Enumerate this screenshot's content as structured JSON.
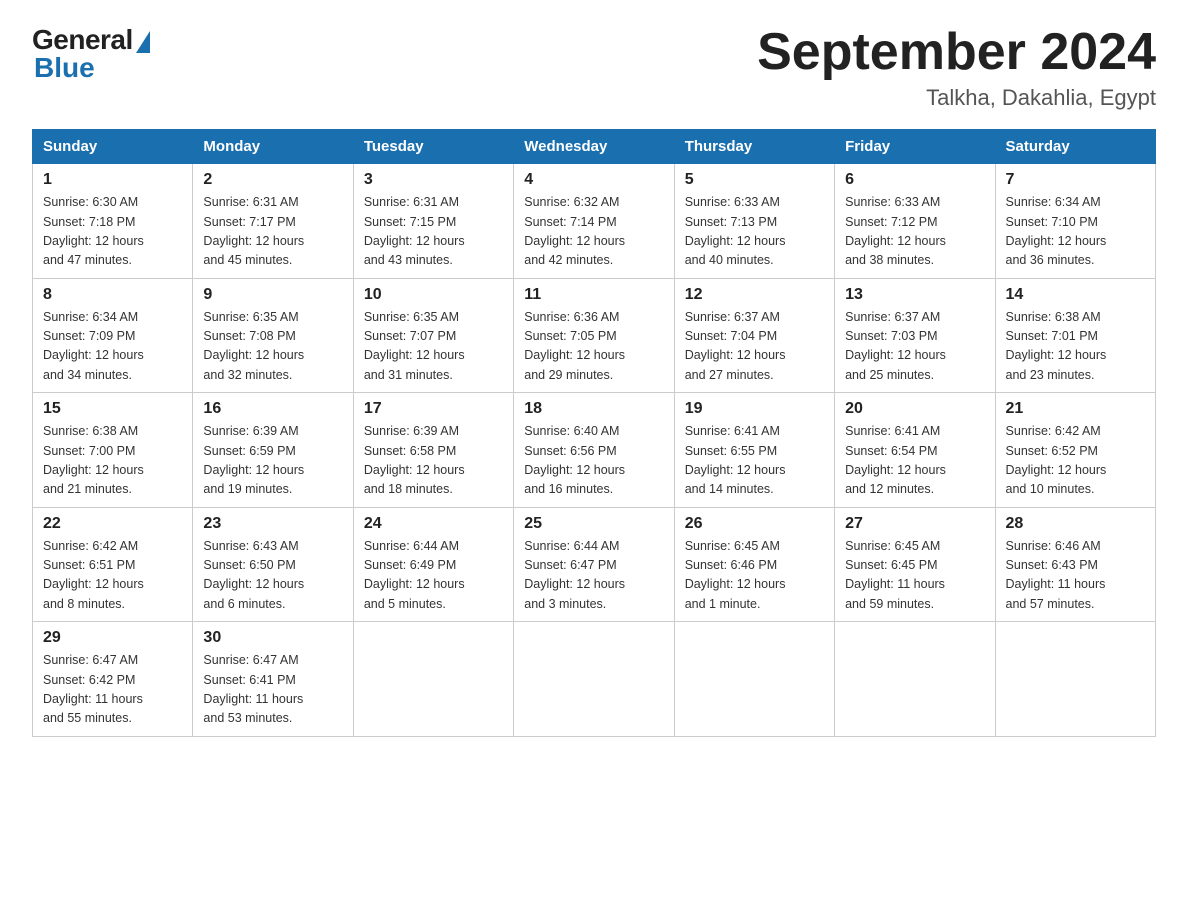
{
  "header": {
    "logo_general": "General",
    "logo_blue": "Blue",
    "month_title": "September 2024",
    "location": "Talkha, Dakahlia, Egypt"
  },
  "weekdays": [
    "Sunday",
    "Monday",
    "Tuesday",
    "Wednesday",
    "Thursday",
    "Friday",
    "Saturday"
  ],
  "weeks": [
    [
      {
        "day": "1",
        "sunrise": "6:30 AM",
        "sunset": "7:18 PM",
        "daylight": "12 hours and 47 minutes."
      },
      {
        "day": "2",
        "sunrise": "6:31 AM",
        "sunset": "7:17 PM",
        "daylight": "12 hours and 45 minutes."
      },
      {
        "day": "3",
        "sunrise": "6:31 AM",
        "sunset": "7:15 PM",
        "daylight": "12 hours and 43 minutes."
      },
      {
        "day": "4",
        "sunrise": "6:32 AM",
        "sunset": "7:14 PM",
        "daylight": "12 hours and 42 minutes."
      },
      {
        "day": "5",
        "sunrise": "6:33 AM",
        "sunset": "7:13 PM",
        "daylight": "12 hours and 40 minutes."
      },
      {
        "day": "6",
        "sunrise": "6:33 AM",
        "sunset": "7:12 PM",
        "daylight": "12 hours and 38 minutes."
      },
      {
        "day": "7",
        "sunrise": "6:34 AM",
        "sunset": "7:10 PM",
        "daylight": "12 hours and 36 minutes."
      }
    ],
    [
      {
        "day": "8",
        "sunrise": "6:34 AM",
        "sunset": "7:09 PM",
        "daylight": "12 hours and 34 minutes."
      },
      {
        "day": "9",
        "sunrise": "6:35 AM",
        "sunset": "7:08 PM",
        "daylight": "12 hours and 32 minutes."
      },
      {
        "day": "10",
        "sunrise": "6:35 AM",
        "sunset": "7:07 PM",
        "daylight": "12 hours and 31 minutes."
      },
      {
        "day": "11",
        "sunrise": "6:36 AM",
        "sunset": "7:05 PM",
        "daylight": "12 hours and 29 minutes."
      },
      {
        "day": "12",
        "sunrise": "6:37 AM",
        "sunset": "7:04 PM",
        "daylight": "12 hours and 27 minutes."
      },
      {
        "day": "13",
        "sunrise": "6:37 AM",
        "sunset": "7:03 PM",
        "daylight": "12 hours and 25 minutes."
      },
      {
        "day": "14",
        "sunrise": "6:38 AM",
        "sunset": "7:01 PM",
        "daylight": "12 hours and 23 minutes."
      }
    ],
    [
      {
        "day": "15",
        "sunrise": "6:38 AM",
        "sunset": "7:00 PM",
        "daylight": "12 hours and 21 minutes."
      },
      {
        "day": "16",
        "sunrise": "6:39 AM",
        "sunset": "6:59 PM",
        "daylight": "12 hours and 19 minutes."
      },
      {
        "day": "17",
        "sunrise": "6:39 AM",
        "sunset": "6:58 PM",
        "daylight": "12 hours and 18 minutes."
      },
      {
        "day": "18",
        "sunrise": "6:40 AM",
        "sunset": "6:56 PM",
        "daylight": "12 hours and 16 minutes."
      },
      {
        "day": "19",
        "sunrise": "6:41 AM",
        "sunset": "6:55 PM",
        "daylight": "12 hours and 14 minutes."
      },
      {
        "day": "20",
        "sunrise": "6:41 AM",
        "sunset": "6:54 PM",
        "daylight": "12 hours and 12 minutes."
      },
      {
        "day": "21",
        "sunrise": "6:42 AM",
        "sunset": "6:52 PM",
        "daylight": "12 hours and 10 minutes."
      }
    ],
    [
      {
        "day": "22",
        "sunrise": "6:42 AM",
        "sunset": "6:51 PM",
        "daylight": "12 hours and 8 minutes."
      },
      {
        "day": "23",
        "sunrise": "6:43 AM",
        "sunset": "6:50 PM",
        "daylight": "12 hours and 6 minutes."
      },
      {
        "day": "24",
        "sunrise": "6:44 AM",
        "sunset": "6:49 PM",
        "daylight": "12 hours and 5 minutes."
      },
      {
        "day": "25",
        "sunrise": "6:44 AM",
        "sunset": "6:47 PM",
        "daylight": "12 hours and 3 minutes."
      },
      {
        "day": "26",
        "sunrise": "6:45 AM",
        "sunset": "6:46 PM",
        "daylight": "12 hours and 1 minute."
      },
      {
        "day": "27",
        "sunrise": "6:45 AM",
        "sunset": "6:45 PM",
        "daylight": "11 hours and 59 minutes."
      },
      {
        "day": "28",
        "sunrise": "6:46 AM",
        "sunset": "6:43 PM",
        "daylight": "11 hours and 57 minutes."
      }
    ],
    [
      {
        "day": "29",
        "sunrise": "6:47 AM",
        "sunset": "6:42 PM",
        "daylight": "11 hours and 55 minutes."
      },
      {
        "day": "30",
        "sunrise": "6:47 AM",
        "sunset": "6:41 PM",
        "daylight": "11 hours and 53 minutes."
      },
      null,
      null,
      null,
      null,
      null
    ]
  ]
}
